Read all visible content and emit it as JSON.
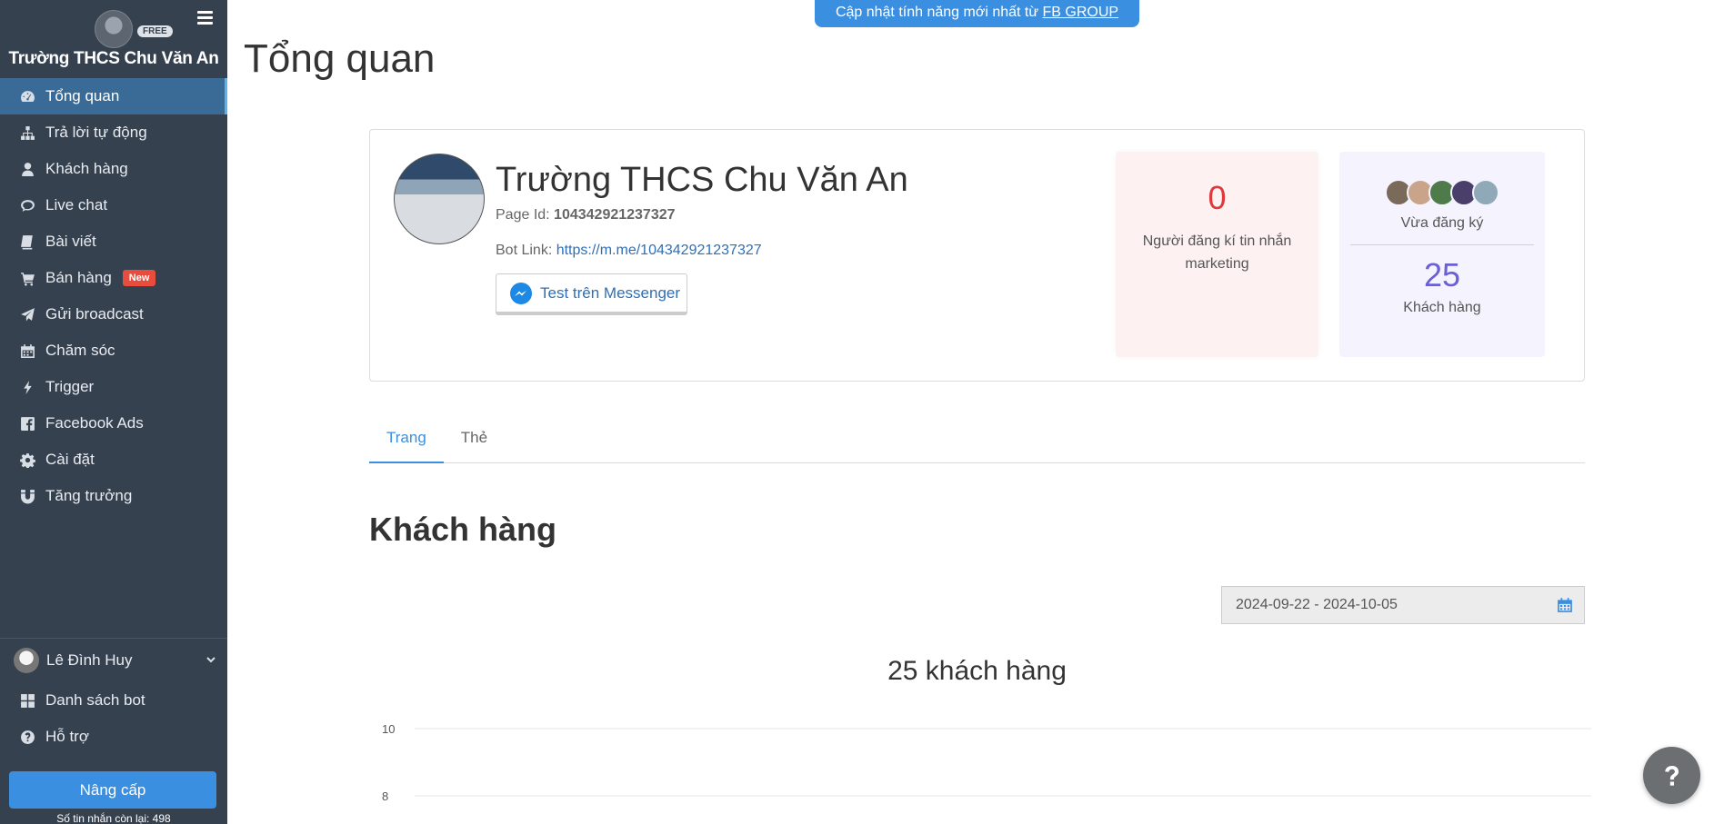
{
  "top_notice": {
    "text": "Cập nhật tính năng mới nhất từ ",
    "link": "FB GROUP"
  },
  "sidebar": {
    "brand_name": "Trường THCS Chu Văn An",
    "plan_badge": "FREE",
    "items": [
      {
        "label": "Tổng quan",
        "icon": "dashboard-icon",
        "active": true
      },
      {
        "label": "Trả lời tự động",
        "icon": "sitemap-icon"
      },
      {
        "label": "Khách hàng",
        "icon": "user-icon"
      },
      {
        "label": "Live chat",
        "icon": "chat-icon"
      },
      {
        "label": "Bài viết",
        "icon": "book-icon"
      },
      {
        "label": "Bán hàng",
        "icon": "cart-icon",
        "badge": "New"
      },
      {
        "label": "Gửi broadcast",
        "icon": "paper-plane-icon"
      },
      {
        "label": "Chăm sóc",
        "icon": "calendar-icon"
      },
      {
        "label": "Trigger",
        "icon": "bolt-icon"
      },
      {
        "label": "Facebook Ads",
        "icon": "facebook-icon"
      },
      {
        "label": "Cài đặt",
        "icon": "gear-icon"
      },
      {
        "label": "Tăng trưởng",
        "icon": "magnet-icon"
      }
    ],
    "user_name": "Lê Đình Huy",
    "bottom_items": [
      {
        "label": "Danh sách bot",
        "icon": "grid-icon"
      },
      {
        "label": "Hỗ trợ",
        "icon": "question-circle-icon"
      }
    ],
    "upgrade_label": "Nâng cấp",
    "messages_left": "Số tin nhắn còn lại: 498"
  },
  "page_title": "Tổng quan",
  "page_card": {
    "name": "Trường THCS Chu Văn An",
    "page_id_label": "Page Id: ",
    "page_id": "104342921237327",
    "bot_link_label": "Bot Link: ",
    "bot_link": "https://m.me/104342921237327",
    "test_button": "Test trên Messenger",
    "marketing_count": "0",
    "marketing_label": "Người đăng kí tin nhắn marketing",
    "recent_label": "Vừa đăng ký",
    "customer_count": "25",
    "customer_label": "Khách hàng",
    "colors": {
      "pink_number": "#e0393b",
      "purple_number": "#6b5fd6"
    }
  },
  "tabs": [
    {
      "label": "Trang",
      "active": true
    },
    {
      "label": "Thẻ"
    }
  ],
  "section_title": "Khách hàng",
  "date_range": "2024-09-22 - 2024-10-05",
  "chart_data": {
    "type": "line",
    "title": "25 khách hàng",
    "ylim": [
      8,
      10
    ],
    "yticks": [
      "10",
      "8"
    ],
    "series": []
  },
  "accent_color": "#3b8fe0"
}
